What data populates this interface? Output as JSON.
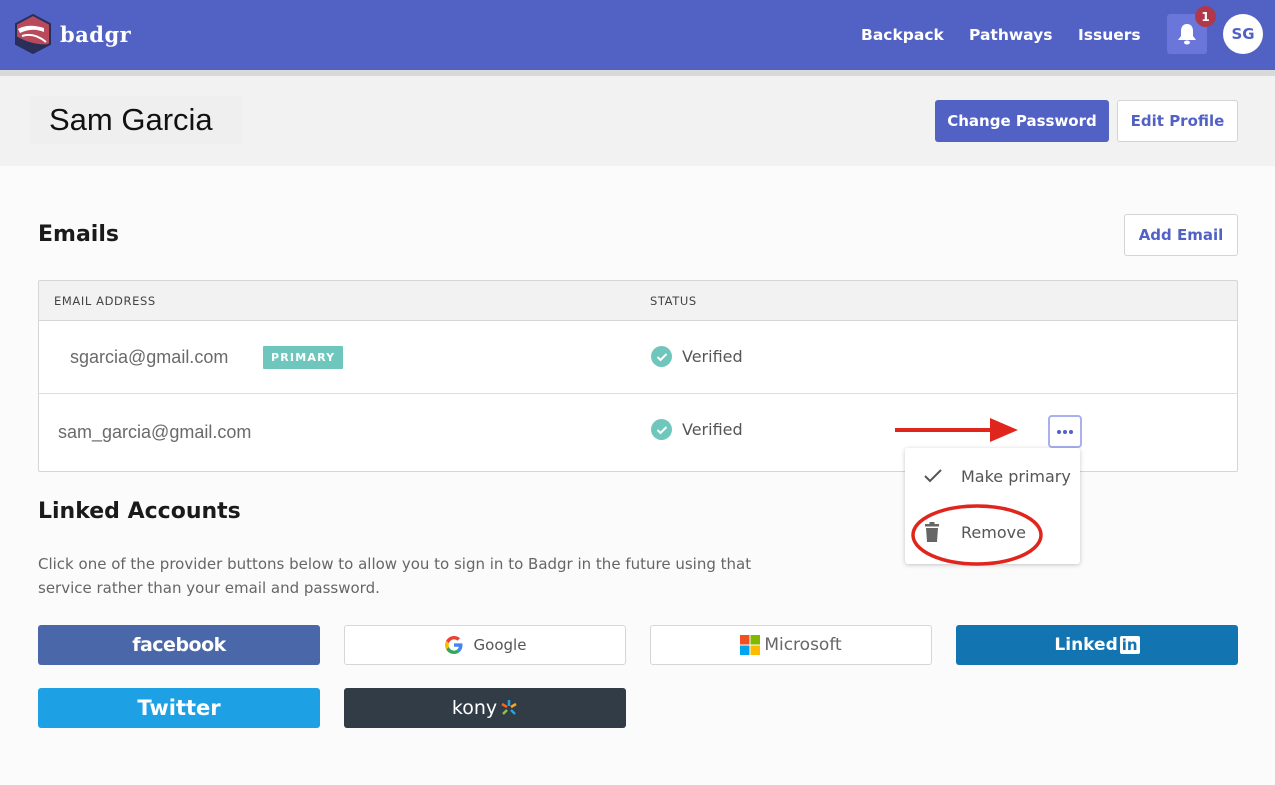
{
  "header": {
    "brand": "badgr",
    "nav": [
      "Backpack",
      "Pathways",
      "Issuers"
    ],
    "notification_count": "1",
    "avatar_initials": "SG",
    "colors": {
      "primary": "#5261c4",
      "badge": "#b1384a"
    }
  },
  "profile": {
    "name": "Sam Garcia",
    "change_password_label": "Change Password",
    "edit_profile_label": "Edit Profile"
  },
  "emails": {
    "title": "Emails",
    "add_label": "Add Email",
    "columns": [
      "EMAIL ADDRESS",
      "STATUS"
    ],
    "rows": [
      {
        "address": "sgarcia@gmail.com",
        "badge": "PRIMARY",
        "status": "Verified"
      },
      {
        "address": "sam_garcia@gmail.com",
        "status": "Verified"
      }
    ],
    "menu": [
      "Make primary",
      "Remove"
    ]
  },
  "linked": {
    "title": "Linked Accounts",
    "description": "Click one of the provider buttons below to allow you to sign in to Badgr in the future using that service rather than your email and password.",
    "providers": {
      "facebook": "facebook",
      "google": "Google",
      "microsoft": "Microsoft",
      "linkedin": "Linked",
      "linkedin_in": "in",
      "twitter": "Twitter",
      "kony": "kony"
    }
  }
}
